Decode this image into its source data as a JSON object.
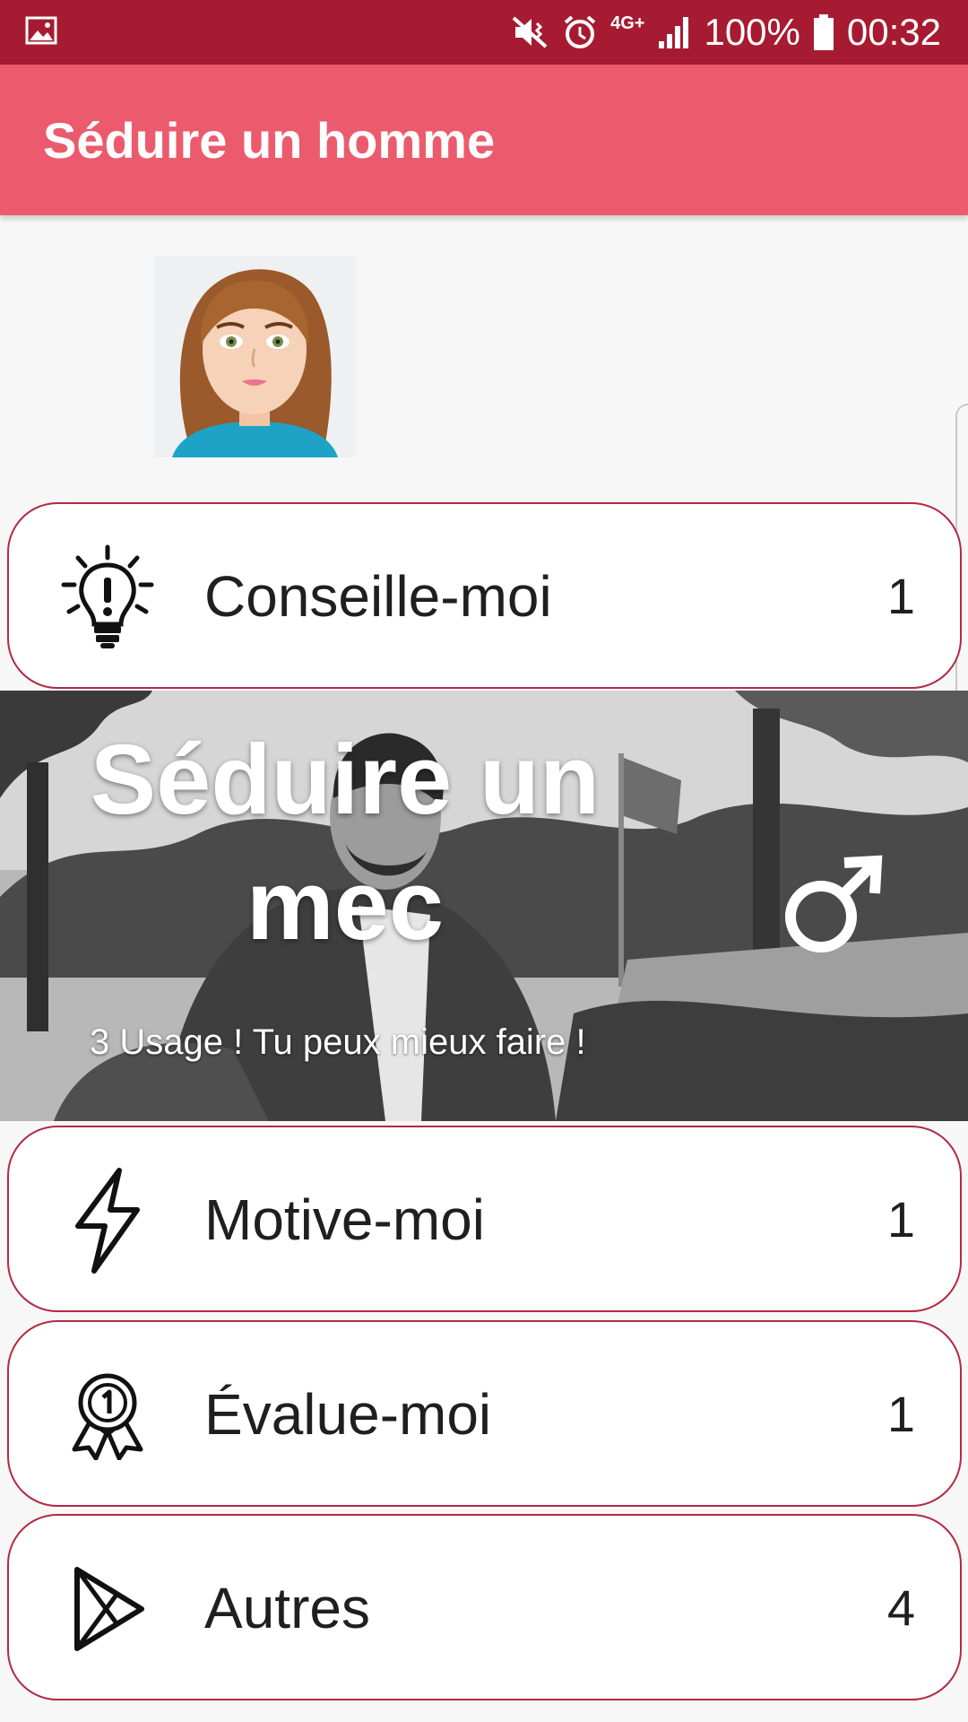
{
  "status_bar": {
    "battery": "100%",
    "time": "00:32",
    "network": "4G+",
    "icons": [
      "gallery-icon",
      "mute-vibrate-icon",
      "alarm-icon",
      "network-4g-icon",
      "signal-icon",
      "battery-icon"
    ]
  },
  "app_bar": {
    "title": "Séduire un homme"
  },
  "cards": [
    {
      "label": "Conseille-moi",
      "count": "1",
      "icon": "lightbulb-icon"
    },
    {
      "label": "Motive-moi",
      "count": "1",
      "icon": "lightning-icon"
    },
    {
      "label": "Évalue-moi",
      "count": "1",
      "icon": "award-ribbon-icon"
    },
    {
      "label": "Autres",
      "count": "4",
      "icon": "play-store-icon"
    }
  ],
  "banner": {
    "headline": "Séduire un mec",
    "subtitle": "3 Usage ! Tu peux mieux faire !",
    "icon": "male-symbol-icon"
  },
  "colors": {
    "status_bar": "#a61b31",
    "app_bar": "#ec5b6d",
    "card_border": "#b22a44",
    "background": "#f7f7f7"
  }
}
